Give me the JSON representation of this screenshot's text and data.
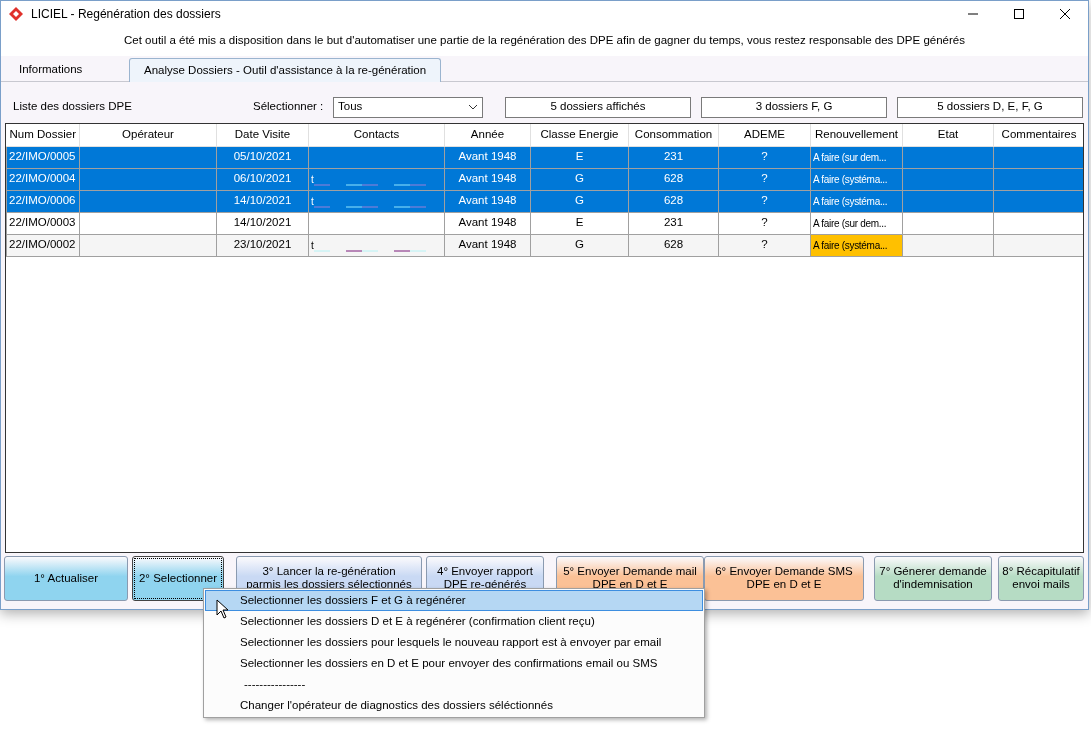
{
  "window": {
    "title": "LICIEL - Regénération des dossiers"
  },
  "notice": "Cet outil a été mis a disposition dans le but d'automatiser une partie de la regénération des DPE afin de gagner du temps, vous restez responsable des DPE générés",
  "tabs": [
    {
      "label": "Informations",
      "selected": false
    },
    {
      "label": "Analyse Dossiers - Outil d'assistance à la re-génération",
      "selected": true
    }
  ],
  "list_label": "Liste des dossiers DPE",
  "filter": {
    "label": "Sélectionner :",
    "value": "Tous"
  },
  "counters": [
    "5 dossiers affichés",
    "3 dossiers F, G",
    "5 dossiers D, E, F, G"
  ],
  "table": {
    "columns": [
      "Num Dossier",
      "Opérateur",
      "Date Visite",
      "Contacts",
      "Année",
      "Classe Energie",
      "Consommation",
      "ADEME",
      "Renouvellement",
      "Etat",
      "Commentaires"
    ],
    "rows": [
      {
        "selected": true,
        "num": "22/IMO/0005",
        "date": "05/10/2021",
        "contacts": "",
        "redacted": false,
        "annee": "Avant 1948",
        "classe": "E",
        "conso": "231",
        "ademe": "?",
        "renouvellement": "A faire (sur dem...",
        "highlight": false
      },
      {
        "selected": true,
        "num": "22/IMO/0004",
        "date": "06/10/2021",
        "contacts": "t",
        "redacted": true,
        "annee": "Avant 1948",
        "classe": "G",
        "conso": "628",
        "ademe": "?",
        "renouvellement": "A faire (systéma...",
        "highlight": false
      },
      {
        "selected": true,
        "num": "22/IMO/0006",
        "date": "14/10/2021",
        "contacts": "t",
        "redacted": true,
        "annee": "Avant 1948",
        "classe": "G",
        "conso": "628",
        "ademe": "?",
        "renouvellement": "A faire (systéma...",
        "highlight": false
      },
      {
        "selected": false,
        "num": "22/IMO/0003",
        "date": "14/10/2021",
        "contacts": "",
        "redacted": false,
        "annee": "Avant 1948",
        "classe": "E",
        "conso": "231",
        "ademe": "?",
        "renouvellement": "A faire (sur dem...",
        "highlight": false
      },
      {
        "selected": false,
        "num": "22/IMO/0002",
        "date": "23/10/2021",
        "contacts": "t",
        "redacted": true,
        "annee": "Avant 1948",
        "classe": "G",
        "conso": "628",
        "ademe": "?",
        "renouvellement": "A faire (systéma...",
        "highlight": true
      }
    ]
  },
  "buttons": [
    {
      "lines": [
        "1° Actualiser"
      ],
      "color": "#8fd4ef",
      "focused": false
    },
    {
      "lines": [
        "2° Selectionner"
      ],
      "color": "#8fd4ef",
      "focused": true
    },
    {
      "lines": [
        "3° Lancer la re-génération",
        "parmis les dossiers sélectionnés"
      ],
      "color": "#c9d9f4",
      "focused": false
    },
    {
      "lines": [
        "4° Envoyer rapport",
        "DPE re-générés"
      ],
      "color": "#c9d9f4",
      "focused": false
    },
    {
      "lines": [
        "5° Envoyer Demande mail",
        "DPE en D et E"
      ],
      "color": "#fbc196",
      "focused": false
    },
    {
      "lines": [
        "6° Envoyer Demande SMS",
        "DPE en D et E"
      ],
      "color": "#fbc196",
      "focused": false
    },
    {
      "lines": [
        "7° Génerer demande",
        "d'indemnisation"
      ],
      "color": "#b6dcc4",
      "focused": false
    },
    {
      "lines": [
        "8° Récapitulatif",
        "envoi mails"
      ],
      "color": "#b6dcc4",
      "focused": false
    }
  ],
  "menu": [
    {
      "kind": "item",
      "label": "Selectionner les dossiers F et G à regénérer",
      "selected": true
    },
    {
      "kind": "item",
      "label": "Selectionner les dossiers D et E à regénérer (confirmation client reçu)",
      "selected": false
    },
    {
      "kind": "item",
      "label": "Selectionner les dossiers pour lesquels le nouveau rapport est à envoyer par email",
      "selected": false
    },
    {
      "kind": "item",
      "label": "Selectionner les dossiers en D et E pour envoyer des confirmations email ou SMS",
      "selected": false
    },
    {
      "kind": "separator",
      "label": "----------------",
      "selected": false
    },
    {
      "kind": "item",
      "label": "Changer l'opérateur de diagnostics des dossiers séléctionnés",
      "selected": false
    }
  ]
}
